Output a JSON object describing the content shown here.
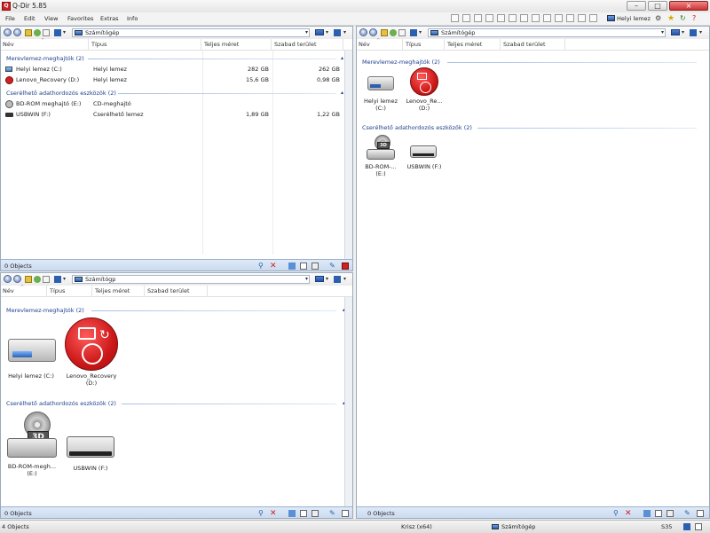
{
  "window": {
    "title": "Q-Dir 5.85"
  },
  "menu": [
    "File",
    "Edit",
    "View",
    "Favorites",
    "Extras",
    "Info"
  ],
  "toolbar_right": {
    "label": "Helyi lemez"
  },
  "headers": [
    "Név",
    "Típus",
    "Teljes méret",
    "Szabad terület"
  ],
  "address": "Számítógép",
  "address_short": "Számítógp",
  "groups": {
    "hdd": "Merevlemez-meghajtók (2)",
    "removable": "Cserélhető adathordozós eszközök (2)"
  },
  "rows": {
    "hdd": [
      {
        "name": "Helyi lemez (C:)",
        "type": "Helyi lemez",
        "total": "282 GB",
        "free": "262 GB"
      },
      {
        "name": "Lenovo_Recovery (D:)",
        "type": "Helyi lemez",
        "total": "15,6 GB",
        "free": "0,98 GB"
      }
    ],
    "removable": [
      {
        "name": "BD-ROM meghajtó (E:)",
        "type": "CD-meghajtó",
        "total": "",
        "free": ""
      },
      {
        "name": "USBWIN (F:)",
        "type": "Cserélhető lemez",
        "total": "1,89 GB",
        "free": "1,22 GB"
      }
    ]
  },
  "tiles_q2": {
    "hdd": [
      {
        "label": "Helyi lemez (C:)"
      },
      {
        "label": "Lenovo_Recovery (D:)",
        "label_l1": "Lenovo_Recovery",
        "label_l2": "(D:)"
      }
    ],
    "removable": [
      {
        "label_l1": "BD-ROM-megh...",
        "label_l2": "(E:)"
      },
      {
        "label": "USBWIN (F:)"
      }
    ]
  },
  "tiles_q3": {
    "hdd": [
      {
        "label_l1": "Helyi lemez",
        "label_l2": "(C:)"
      },
      {
        "label_l1": "Lenovo_Re...",
        "label_l2": "(D:)"
      }
    ],
    "removable": [
      {
        "label_l1": "BD-ROM-...",
        "label_l2": "(E:)"
      },
      {
        "label": "USBWIN (F:)"
      }
    ]
  },
  "pane_status": "0 Objects",
  "bd_badge": "3D",
  "statusbar": {
    "objects": "4 Objects",
    "user": "Krisz (x64)",
    "location": "Számítógép",
    "code": "S35"
  },
  "colors": {
    "accent": "#2b5fb0",
    "close": "#cc2222",
    "group": "#1f3f8f"
  }
}
